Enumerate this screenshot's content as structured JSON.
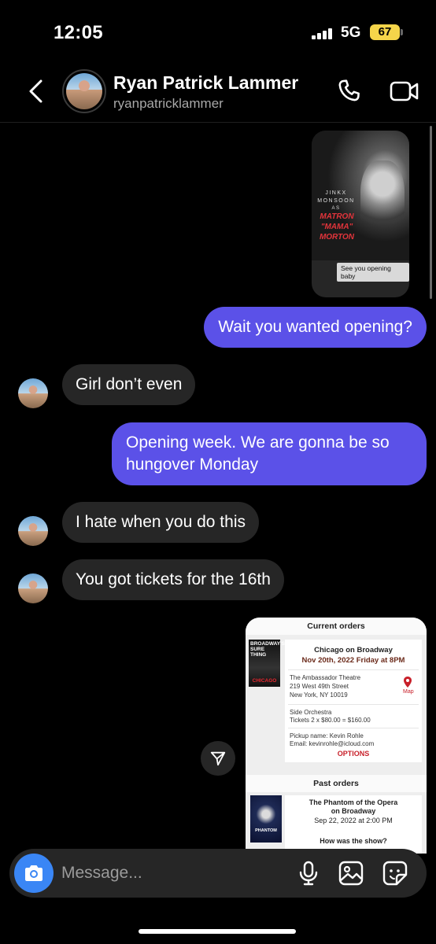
{
  "status_bar": {
    "time": "12:05",
    "network": "5G",
    "battery": "67"
  },
  "header": {
    "name": "Ryan Patrick Lammer",
    "handle": "ryanpatricklammer"
  },
  "story_reply": {
    "line1": "JINKX",
    "line2": "MONSOON",
    "line3": "AS",
    "title1": "MATRON",
    "title2": "\"MAMA\"",
    "title3": "MORTON",
    "reply": "See you opening baby"
  },
  "messages": [
    {
      "direction": "sent",
      "text": "Wait you wanted opening?"
    },
    {
      "direction": "received",
      "text": "Girl don’t even"
    },
    {
      "direction": "sent",
      "text": "Opening week. We are gonna be so hungover Monday"
    },
    {
      "direction": "received",
      "text": "I hate when you do this"
    },
    {
      "direction": "received",
      "text": "You got tickets for the 16th"
    }
  ],
  "shared_image": {
    "current_header": "Current orders",
    "thumb_top": "BROADWAY'S SURE THING",
    "thumb_bottom": "CHICAGO",
    "show": "Chicago on Broadway",
    "date": "Nov 20th, 2022 Friday at 8PM",
    "venue1": "The Ambassador Theatre",
    "venue2": "219 West 49th Street",
    "venue3": "New York, NY 10019",
    "map": "Map",
    "seat1": "Side Orchestra",
    "seat2": "Tickets 2 x $80.00 = $160.00",
    "pickup1": "Pickup name: Kevin Rohle",
    "pickup2": "Email: kevinrohle@icloud.com",
    "options": "OPTIONS",
    "past_header": "Past orders",
    "past_thumb": "PHANTOM",
    "past_show1": "The Phantom of the Opera",
    "past_show2": "on Broadway",
    "past_date": "Sep 22, 2022 at 2:00 PM",
    "past_question": "How was the show?"
  },
  "composer": {
    "placeholder": "Message..."
  },
  "colors": {
    "sent_bubble": "#5b51e8",
    "received_bubble": "#262626",
    "camera": "#3a86f5",
    "battery": "#f5d54a"
  }
}
